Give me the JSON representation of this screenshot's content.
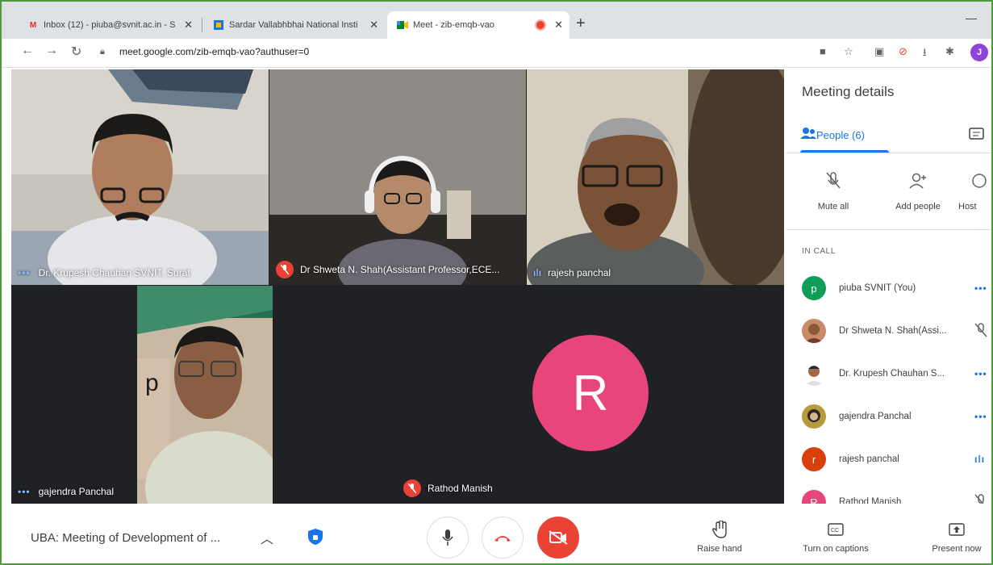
{
  "browser": {
    "tabs": [
      {
        "title": "Inbox (12) - piuba@svnit.ac.in - S",
        "icon": "gmail-icon"
      },
      {
        "title": "Sardar Vallabhbhai National Insti",
        "icon": "site-icon"
      },
      {
        "title": "Meet - zib-emqb-vao",
        "icon": "meet-icon"
      }
    ],
    "url": "meet.google.com/zib-emqb-vao?authuser=0",
    "profile_initial": "J"
  },
  "video_tiles": [
    {
      "name": "Dr. Krupesh Chauhan SVNIT, Surat",
      "status": "more"
    },
    {
      "name": "Dr Shweta N. Shah(Assistant Professor,ECE...",
      "status": "muted"
    },
    {
      "name": "rajesh panchal",
      "status": "speaking"
    },
    {
      "name": "gajendra Panchal",
      "status": "more"
    },
    {
      "name": "Rathod Manish",
      "status": "muted",
      "avatar_letter": "R",
      "avatar_color": "#e8457a"
    }
  ],
  "panel": {
    "title": "Meeting details",
    "people_tab": "People (6)",
    "actions": {
      "mute_all": "Mute all",
      "add_people": "Add people",
      "host": "Host"
    },
    "in_call_label": "IN CALL",
    "participants": [
      {
        "name": "piuba SVNIT (You)",
        "avatar": "p",
        "avatar_color": "#0f9d58",
        "status": "more"
      },
      {
        "name": "Dr Shweta N. Shah(Assi...",
        "avatar": "",
        "avatar_color": "#c98a6b",
        "status": "muted"
      },
      {
        "name": "Dr. Krupesh Chauhan S...",
        "avatar": "",
        "avatar_color": "#8a6a4a",
        "status": "more"
      },
      {
        "name": "gajendra Panchal",
        "avatar": "",
        "avatar_color": "#b99a3a",
        "status": "more"
      },
      {
        "name": "rajesh panchal",
        "avatar": "r",
        "avatar_color": "#d93f0b",
        "status": "speaking"
      },
      {
        "name": "Rathod Manish",
        "avatar": "R",
        "avatar_color": "#e8457a",
        "status": "muted"
      }
    ]
  },
  "bottom": {
    "meeting_title": "UBA: Meeting of Development of ...",
    "raise_hand": "Raise hand",
    "captions": "Turn on captions",
    "present": "Present now"
  },
  "colors": {
    "accent": "#1a73e8",
    "danger": "#ea4335",
    "frame": "#4f9a3a"
  }
}
